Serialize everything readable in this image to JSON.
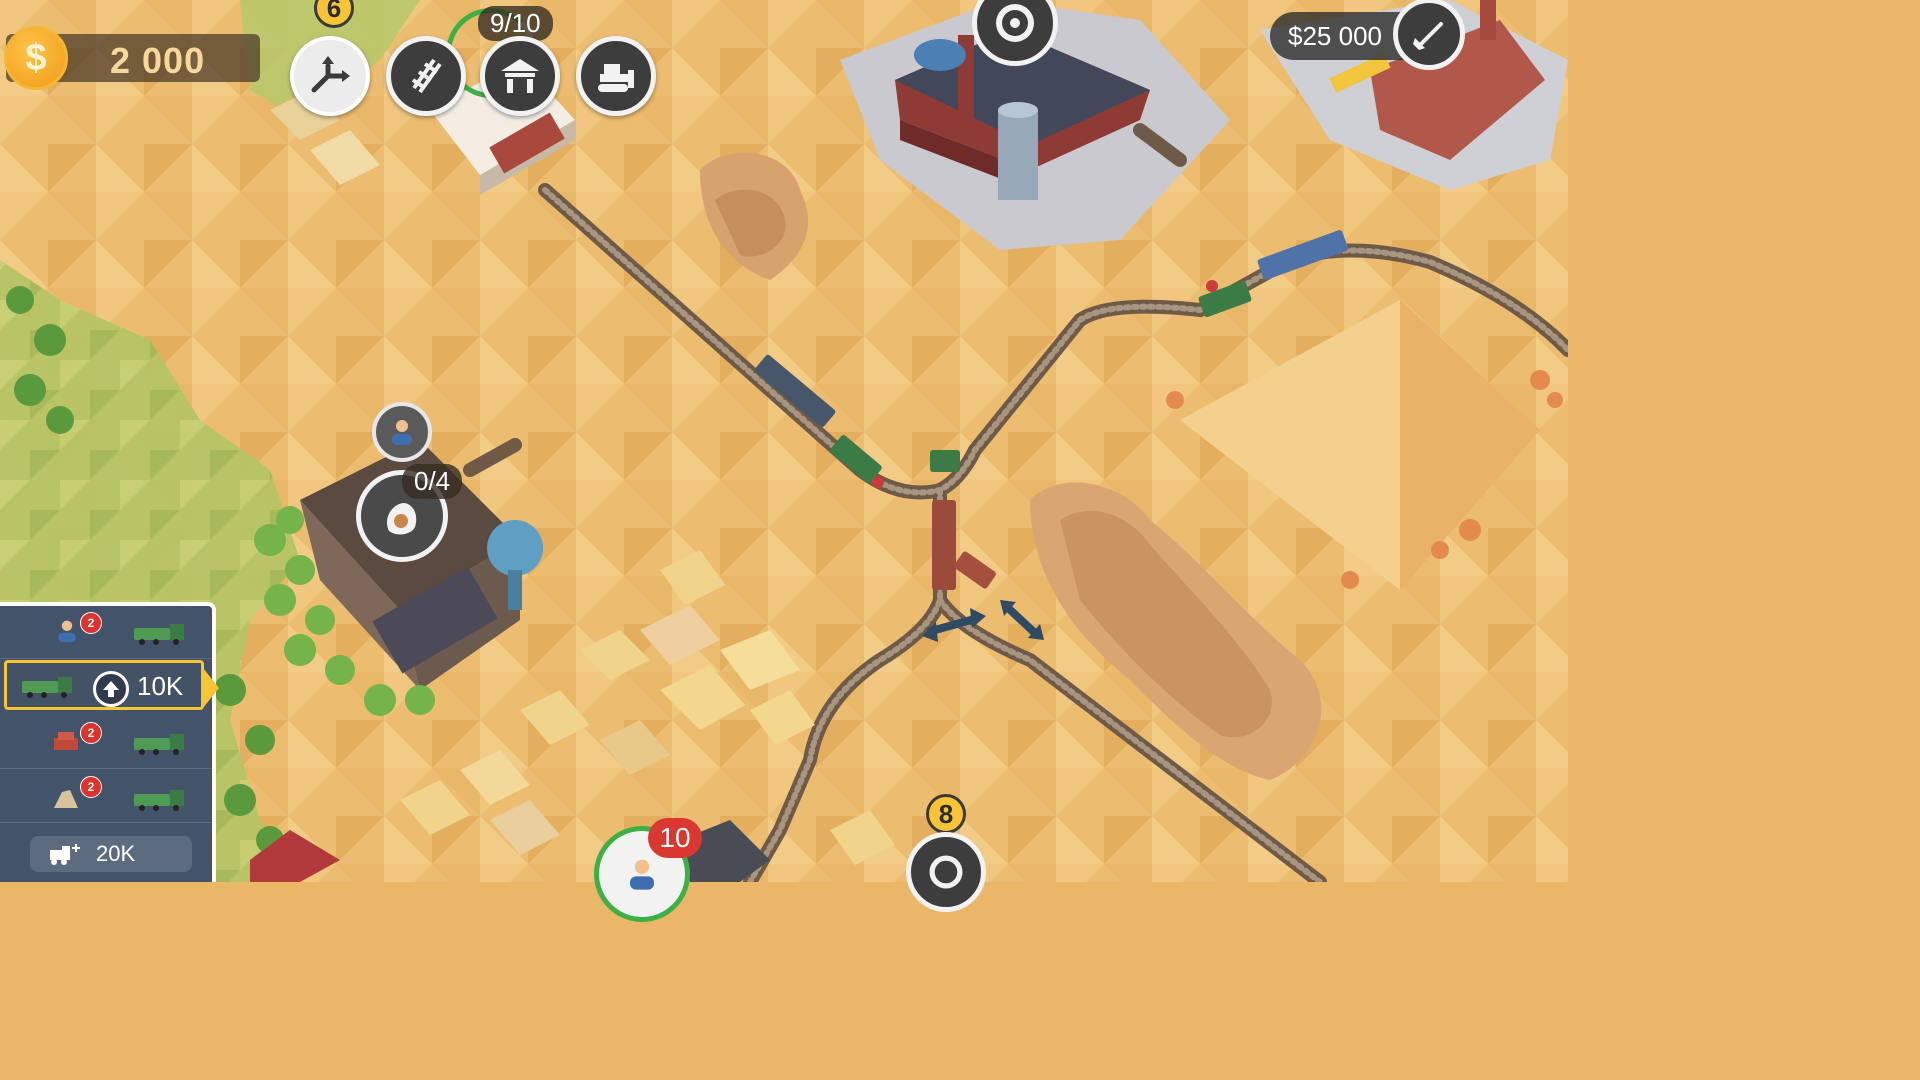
{
  "hud": {
    "coins": "2 000",
    "coin_symbol": "$",
    "station_top_count": "6",
    "station_capacity": "9/10",
    "build_cost": "$25 000"
  },
  "toolbar": {
    "items": [
      {
        "icon": "switch-track-icon"
      },
      {
        "icon": "rail-track-icon"
      },
      {
        "icon": "station-icon"
      },
      {
        "icon": "bulldozer-icon"
      }
    ]
  },
  "map": {
    "mine_capacity": "0/4",
    "bottom_station_count": "8",
    "bottom_station_passengers": "10"
  },
  "train_panel": {
    "rows": [
      {
        "cargo_icon": "passenger-icon",
        "badge": "2"
      },
      {
        "cargo_icon": "locomotive-icon",
        "upgrade_cost": "10K"
      },
      {
        "cargo_icon": "brick-icon",
        "badge": "2"
      },
      {
        "cargo_icon": "stone-icon",
        "badge": "2"
      }
    ],
    "buy_train_cost": "20K"
  },
  "colors": {
    "sand": "#e9b767",
    "accent_yellow": "#f6c435",
    "panel": "#43536a",
    "track": "#6f5a48"
  }
}
